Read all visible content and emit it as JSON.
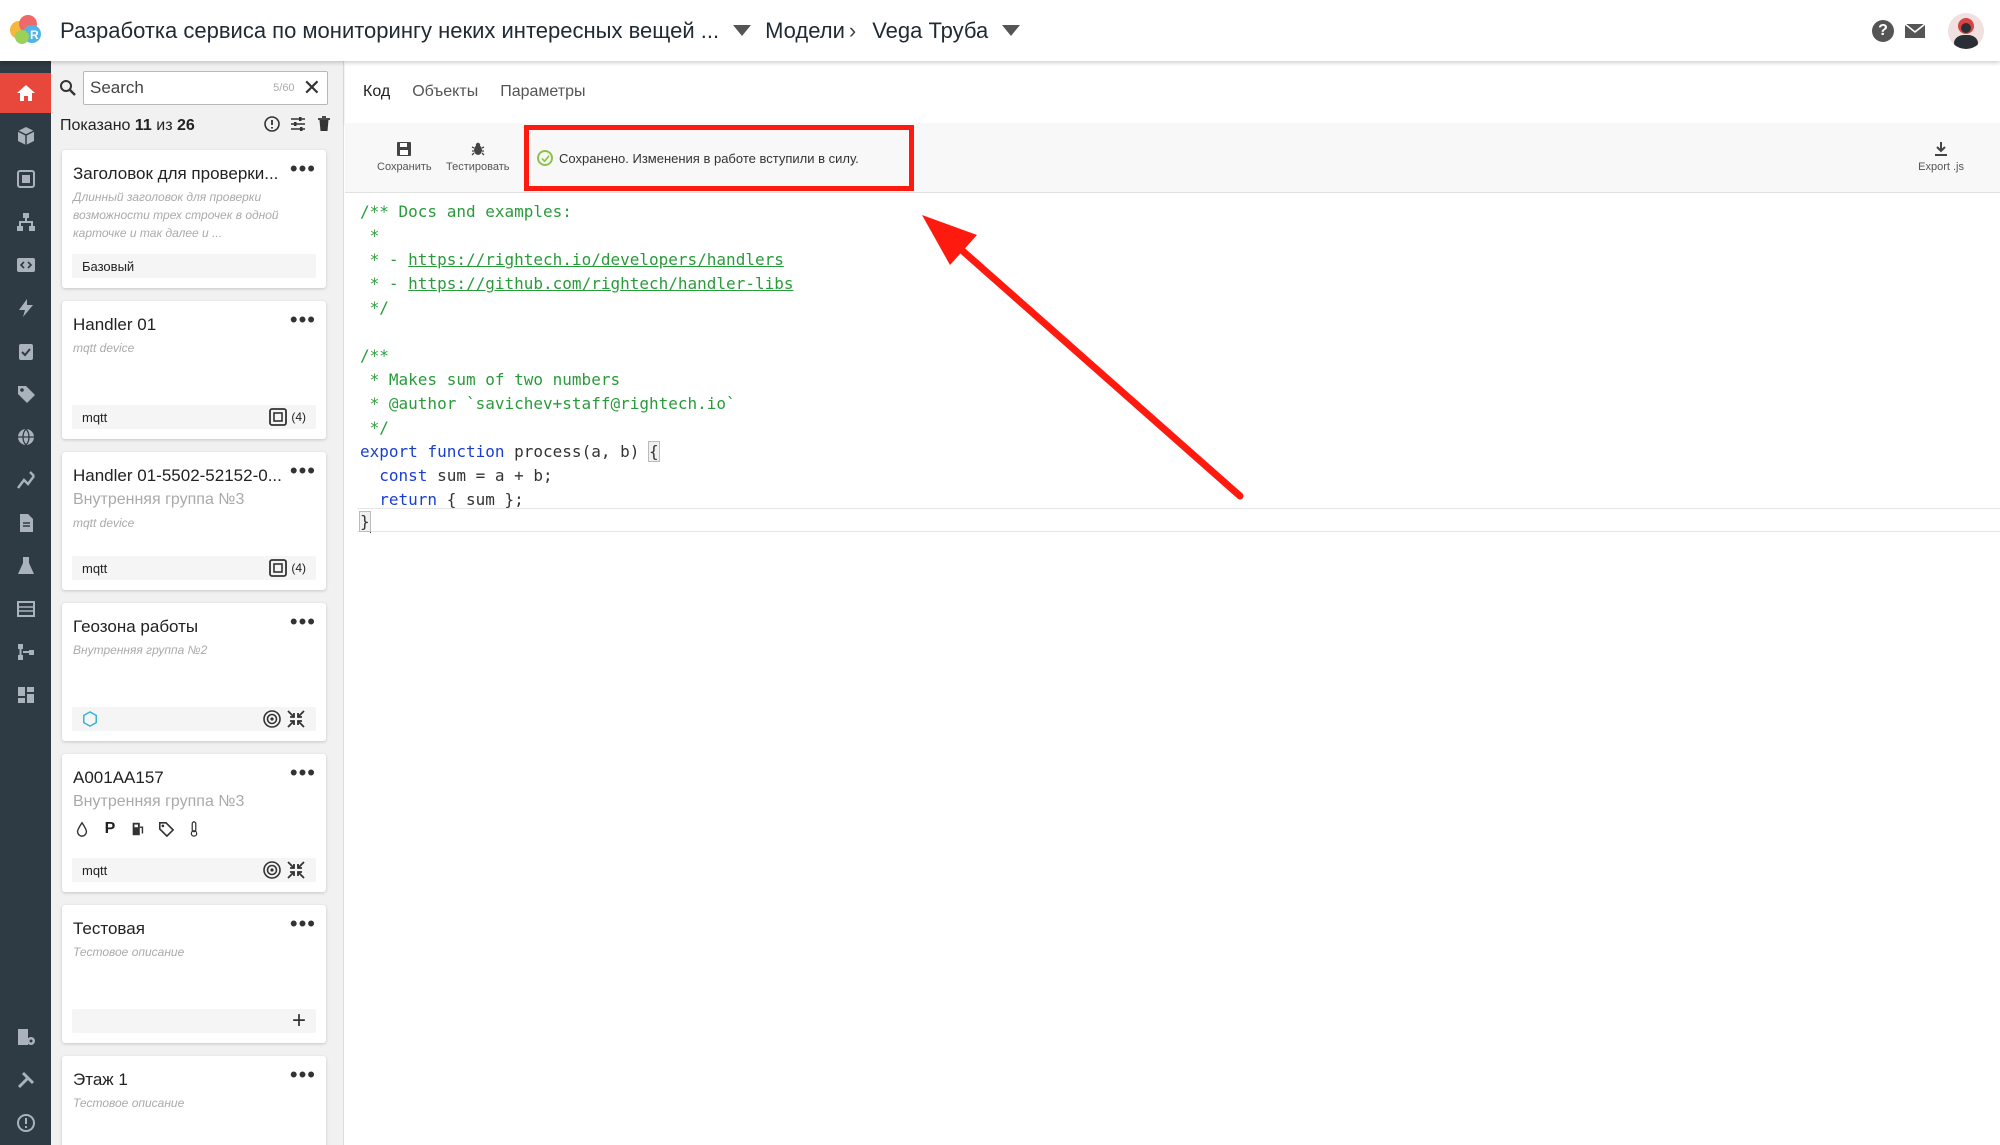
{
  "header": {
    "project_title": "Разработка сервиса по мониторингу неких интересных вещей ...",
    "section": "Модели",
    "model_name": "Vega Труба"
  },
  "sidebar": {
    "search_placeholder": "Search",
    "search_count": "5/60",
    "shown_prefix": "Показано",
    "shown_count": "11",
    "shown_of": "из",
    "shown_total": "26",
    "cards": [
      {
        "title": "Заголовок для проверки...",
        "description": "Длинный заголовок для проверки возможности трех строчек в одной карточке и так далее и ...",
        "tag": "Базовый"
      },
      {
        "title": "Handler 01",
        "description": "mqtt device",
        "tag": "mqtt",
        "count": "(4)"
      },
      {
        "title": "Handler 01-5502-52152-0...",
        "subtitle": "Внутренняя группа №3",
        "description": "mqtt device",
        "tag": "mqtt",
        "count": "(4)"
      },
      {
        "title": "Геозона работы",
        "description": "Внутренняя группа №2"
      },
      {
        "title": "A001AA157",
        "subtitle": "Внутренняя группа №3",
        "tag": "mqtt"
      },
      {
        "title": "Тестовая",
        "description": "Тестовое описание"
      },
      {
        "title": "Этаж 1",
        "description": "Тестовое описание"
      }
    ]
  },
  "tabs": [
    "Код",
    "Объекты",
    "Параметры"
  ],
  "toolbar": {
    "save_label": "Сохранить",
    "test_label": "Тестировать",
    "export_label": "Export .js",
    "status_text": "Сохранено. Изменения в работе вступили в силу."
  },
  "code": {
    "l1": "/** Docs and examples:",
    "l2": " *",
    "l3_prefix": " * - ",
    "l3_link": "https://rightech.io/developers/handlers",
    "l4_prefix": " * - ",
    "l4_link": "https://github.com/rightech/handler-libs",
    "l5": " */",
    "l7": "/**",
    "l8": " * Makes sum of two numbers",
    "l9": " * @author `savichev+staff@rightech.io`",
    "l10": " */",
    "l11_kw1": "export",
    "l11_kw2": "function",
    "l11_rest": " process(a, b) ",
    "l11_brace": "{",
    "l12_kw": "const",
    "l12_rest": " sum = a + b;",
    "l13_kw": "return",
    "l13_rest": " { sum };",
    "l14_brace": "}"
  },
  "colors": {
    "accent": "#e8483b",
    "rail": "#2e3a44",
    "annotation": "#ff1a0f",
    "comment": "#2a9b3b",
    "keyword": "#1a3fd0"
  }
}
